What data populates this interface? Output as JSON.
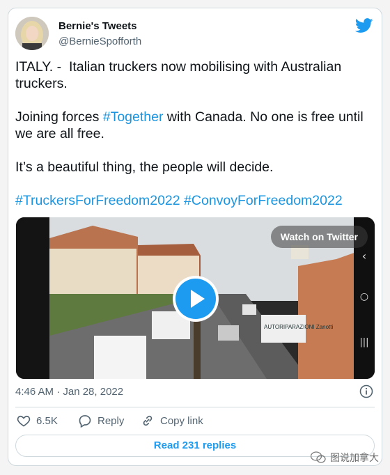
{
  "author": {
    "name": "Bernie's Tweets",
    "handle": "@BernieSpofforth"
  },
  "tweet": {
    "line1": "ITALY. -  Italian truckers now mobilising with Australian truckers.",
    "line2_before": "Joining forces ",
    "line2_tag": "#Together",
    "line2_after": " with Canada. No one is free until we are all free.",
    "line3": "It’s a beautiful thing, the people will decide.",
    "tag1": "#TruckersForFreedom2022",
    "tag2": "#ConvoyForFreedom2022"
  },
  "media": {
    "watch_label": "Watch on Twitter",
    "sign_text": "AUTORIPARAZIONI Zanotti"
  },
  "timestamp": "4:46 AM · Jan 28, 2022",
  "actions": {
    "like_count": "6.5K",
    "reply_label": "Reply",
    "copy_label": "Copy link"
  },
  "read_replies": "Read 231 replies",
  "watermark": "图说加拿大",
  "colors": {
    "accent": "#1d9bf0",
    "hashtag": "#1b95e0",
    "text": "#0f1419",
    "muted": "#536471"
  },
  "icons": [
    "twitter-bird-icon",
    "play-icon",
    "info-icon",
    "heart-icon",
    "reply-icon",
    "link-icon",
    "wechat-icon"
  ]
}
